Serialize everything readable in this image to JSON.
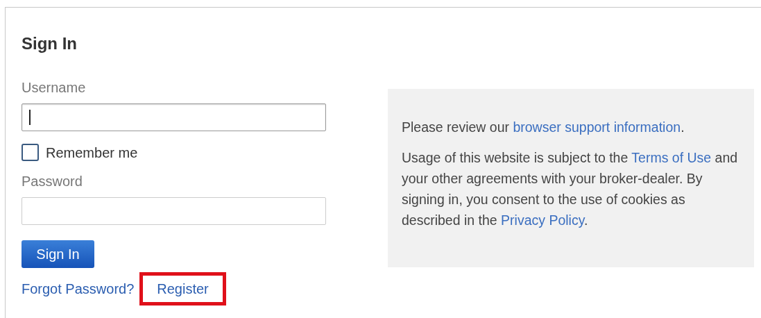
{
  "title": "Sign In",
  "username": {
    "label": "Username",
    "focused": true
  },
  "remember": {
    "label": "Remember me",
    "checked": false
  },
  "password": {
    "label": "Password"
  },
  "submit": "Sign In",
  "links": [
    {
      "label": "Forgot Password?",
      "highlighted": false
    },
    {
      "label": "Register",
      "highlighted": true
    }
  ],
  "info": [
    [
      {
        "kind": "text",
        "text": "Please review our "
      },
      {
        "kind": "link",
        "text": "browser support information"
      },
      {
        "kind": "text",
        "text": "."
      }
    ],
    [
      {
        "kind": "text",
        "text": "Usage of this website is subject to the "
      },
      {
        "kind": "link",
        "text": "Terms of Use"
      },
      {
        "kind": "text",
        "text": " and your other agreements with your broker-dealer. By signing in, you consent to the use of cookies as described in the "
      },
      {
        "kind": "link",
        "text": "Privacy Policy"
      },
      {
        "kind": "text",
        "text": "."
      }
    ]
  ]
}
